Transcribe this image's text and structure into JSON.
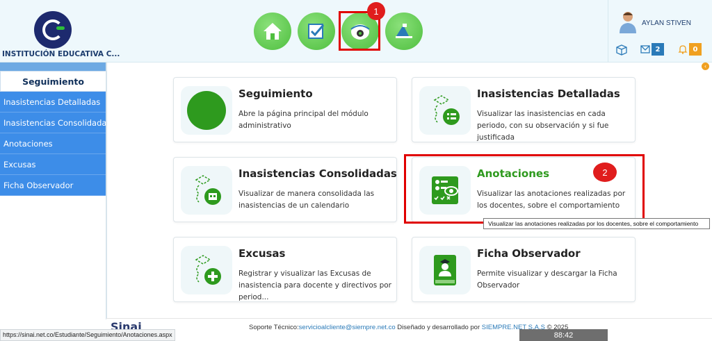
{
  "header": {
    "school_name": "INSTITUCIÓN EDUCATIVA C...",
    "user_name": "AYLAN STIVEN",
    "mail_count": "2",
    "notification_count": "0",
    "nav_icons": [
      "home-icon",
      "checkbox-icon",
      "observer-icon",
      "blackboard-icon"
    ]
  },
  "annotations": {
    "badge_1": "1",
    "badge_2": "2"
  },
  "sidebar": {
    "title": "Seguimiento",
    "items": [
      {
        "label": "Inasistencias Detalladas"
      },
      {
        "label": "Inasistencias Consolidadas"
      },
      {
        "label": "Anotaciones"
      },
      {
        "label": "Excusas"
      },
      {
        "label": "Ficha Observador"
      }
    ]
  },
  "cards": [
    {
      "title": "Seguimiento",
      "desc": "Abre la página principal del módulo administrativo",
      "icon": "green-circle-icon"
    },
    {
      "title": "Inasistencias Detalladas",
      "desc": "Visualizar las inasistencias en cada periodo, con su observación y si fue justificada",
      "icon": "list-detail-icon"
    },
    {
      "title": "Inasistencias Consolidadas",
      "desc": "Visualizar de manera consolidada las inasistencias de un calendario",
      "icon": "calendar-consolidated-icon"
    },
    {
      "title": "Anotaciones",
      "desc": "Visualizar las anotaciones realizadas por los docentes, sobre el comportamiento",
      "icon": "annotations-eye-icon"
    },
    {
      "title": "Excusas",
      "desc": "Registrar y visualizar las Excusas de inasistencia para docente y directivos por period...",
      "icon": "excuse-add-icon"
    },
    {
      "title": "Ficha Observador",
      "desc": "Permite visualizar y descargar la Ficha Observador",
      "icon": "observer-book-icon"
    }
  ],
  "tooltip": "Visualizar las anotaciones realizadas por los docentes, sobre el comportamiento",
  "footer": {
    "logo": "Sinai",
    "support_label": "Soporte Técnico:",
    "support_email": "servicioalcliente@siempre.net.co",
    "designed_by": " Diseñado y desarrollado por ",
    "company": "SIEMPRE.NET S.A.S",
    "year": " © 2025"
  },
  "timer": "88:42",
  "status_url": "https://sinai.net.co/Estudiante/Seguimiento/Anotaciones.aspx",
  "colors": {
    "sidebar_blue": "#3d8de8",
    "accent_green": "#2e9a1e",
    "annotation_red": "#e00000"
  }
}
